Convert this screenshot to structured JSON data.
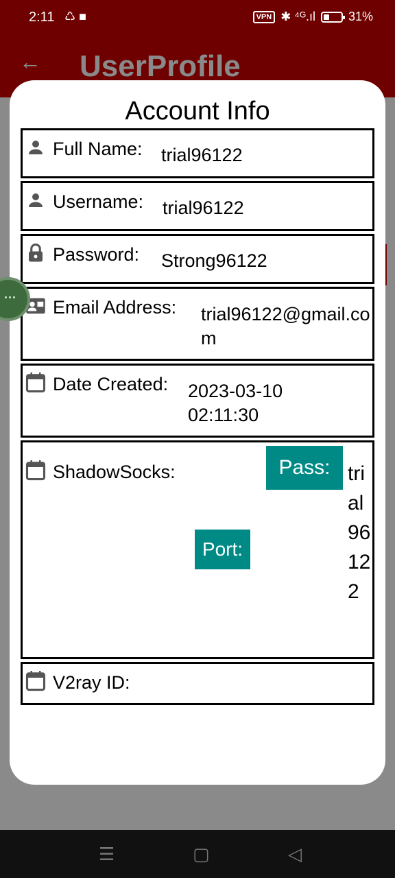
{
  "status_bar": {
    "time": "2:11",
    "notification_icons": "♺ ■",
    "vpn": "VPN",
    "signal": "✱ ⁴ᴳ.ıl",
    "battery": "31%"
  },
  "app_bar": {
    "title": "UserProfile"
  },
  "side_bubble": "···",
  "dialog": {
    "title": "Account Info",
    "fields": [
      {
        "label": "Full Name:",
        "value": "trial96122",
        "icon": "person-icon"
      },
      {
        "label": "Username:",
        "value": "trial96122",
        "icon": "person-icon"
      },
      {
        "label": "Password:",
        "value": "Strong96122",
        "icon": "lock-icon"
      },
      {
        "label": "Email Address:",
        "value": "trial96122@gmail.com",
        "icon": "contact-card-icon"
      },
      {
        "label": "Date Created:",
        "value": "2023-03-10 02:11:30",
        "icon": "calendar-icon"
      }
    ],
    "shadowsocks": {
      "label": "ShadowSocks:",
      "pass_label": "Pass:",
      "pass_value": "trial96122",
      "port_label": "Port:",
      "icon": "calendar-icon"
    },
    "v2ray": {
      "label": "V2ray ID:",
      "icon": "calendar-icon"
    }
  },
  "colors": {
    "app_bar": "#6e0000",
    "teal_button": "#008a85"
  }
}
